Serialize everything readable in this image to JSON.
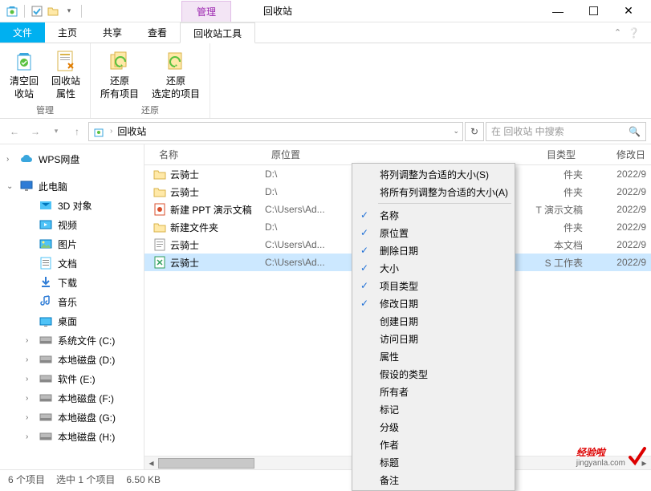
{
  "titlebar": {
    "tab_manage": "管理",
    "tab_recycle": "回收站"
  },
  "menubar": {
    "file": "文件",
    "home": "主页",
    "share": "共享",
    "view": "查看",
    "tools": "回收站工具"
  },
  "ribbon": {
    "group1": {
      "empty": "清空回\n收站",
      "props": "回收站\n属性",
      "name": "管理"
    },
    "group2": {
      "restore_all": "还原\n所有项目",
      "restore_sel": "还原\n选定的项目",
      "name": "还原"
    }
  },
  "address": {
    "location": "回收站"
  },
  "search": {
    "placeholder": "在 回收站 中搜索"
  },
  "columns": {
    "name": "名称",
    "orig": "原位置",
    "type": "目类型",
    "modified": "修改日"
  },
  "sidebar": {
    "wps": "WPS网盘",
    "pc": "此电脑",
    "items": [
      {
        "label": "3D 对象"
      },
      {
        "label": "视频"
      },
      {
        "label": "图片"
      },
      {
        "label": "文档"
      },
      {
        "label": "下载"
      },
      {
        "label": "音乐"
      },
      {
        "label": "桌面"
      },
      {
        "label": "系统文件 (C:)"
      },
      {
        "label": "本地磁盘 (D:)"
      },
      {
        "label": "软件 (E:)"
      },
      {
        "label": "本地磁盘 (F:)"
      },
      {
        "label": "本地磁盘 (G:)"
      },
      {
        "label": "本地磁盘 (H:)"
      }
    ]
  },
  "files": [
    {
      "name": "云骑士",
      "loc": "D:\\",
      "type": "件夹",
      "mod": "2022/9",
      "icon": "folder"
    },
    {
      "name": "云骑士",
      "loc": "D:\\",
      "type": "件夹",
      "mod": "2022/9",
      "icon": "folder"
    },
    {
      "name": "新建 PPT 演示文稿",
      "loc": "C:\\Users\\Ad...",
      "type": "T 演示文稿",
      "mod": "2022/9",
      "icon": "ppt"
    },
    {
      "name": "新建文件夹",
      "loc": "D:\\",
      "type": "件夹",
      "mod": "2022/9",
      "icon": "folder"
    },
    {
      "name": "云骑士",
      "loc": "C:\\Users\\Ad...",
      "type": "本文档",
      "mod": "2022/9",
      "icon": "txt"
    },
    {
      "name": "云骑士",
      "loc": "C:\\Users\\Ad...",
      "type": "S 工作表",
      "mod": "2022/9",
      "icon": "xls",
      "selected": true
    }
  ],
  "context": {
    "size_fit": "将列调整为合适的大小(S)",
    "size_all": "将所有列调整为合适的大小(A)",
    "items": [
      {
        "label": "名称",
        "checked": true
      },
      {
        "label": "原位置",
        "checked": true
      },
      {
        "label": "删除日期",
        "checked": true
      },
      {
        "label": "大小",
        "checked": true
      },
      {
        "label": "项目类型",
        "checked": true
      },
      {
        "label": "修改日期",
        "checked": true
      },
      {
        "label": "创建日期",
        "checked": false
      },
      {
        "label": "访问日期",
        "checked": false
      },
      {
        "label": "属性",
        "checked": false
      },
      {
        "label": "假设的类型",
        "checked": false
      },
      {
        "label": "所有者",
        "checked": false
      },
      {
        "label": "标记",
        "checked": false
      },
      {
        "label": "分级",
        "checked": false
      },
      {
        "label": "作者",
        "checked": false
      },
      {
        "label": "标题",
        "checked": false
      },
      {
        "label": "备注",
        "checked": false
      }
    ]
  },
  "status": {
    "count": "6 个项目",
    "selected": "选中 1 个项目",
    "size": "6.50 KB"
  },
  "watermark": {
    "main": "经验啦",
    "sub": "jingyanla.com"
  }
}
